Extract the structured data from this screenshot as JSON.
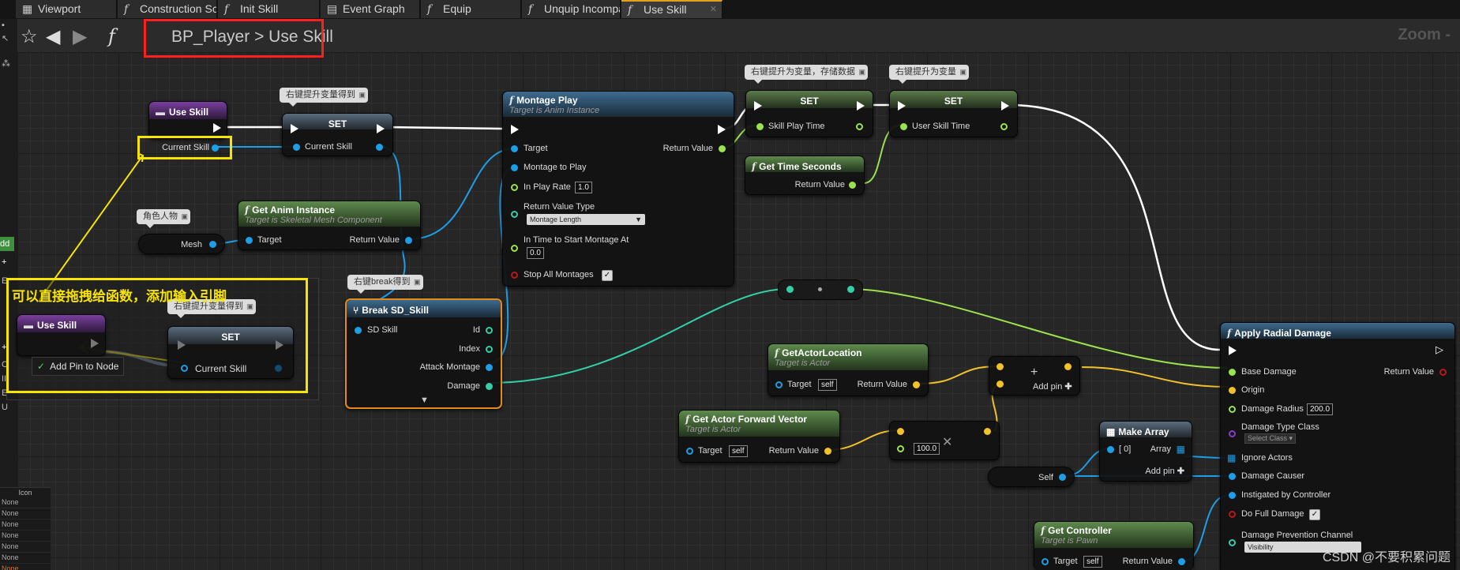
{
  "tabs": [
    {
      "label": "Viewport",
      "icon": "viewport-icon"
    },
    {
      "label": "Construction Scrip",
      "icon": "function-icon"
    },
    {
      "label": "Init Skill",
      "icon": "function-icon"
    },
    {
      "label": "Event Graph",
      "icon": "event-graph-icon"
    },
    {
      "label": "Equip",
      "icon": "function-icon"
    },
    {
      "label": "Unquip Incompatil:",
      "icon": "function-icon"
    },
    {
      "label": "Use Skill",
      "icon": "function-icon",
      "active": true
    }
  ],
  "toolbar": {
    "star_icon": "star-icon",
    "back_icon": "back-arrow-icon",
    "forward_icon": "forward-arrow-icon",
    "function_icon": "function-icon"
  },
  "breadcrumb": {
    "blueprint": "BP_Player",
    "separator": ">",
    "function": "Use Skill"
  },
  "zoom_label": "Zoom -",
  "left_panel": {
    "add_label": "dd",
    "letters": [
      "C",
      "II",
      "E",
      "U"
    ],
    "details_header": "Icon",
    "details_rows": [
      "None",
      "None",
      "None",
      "None",
      "None",
      "None",
      "None"
    ]
  },
  "comments": {
    "set1": "右键提升变量得到",
    "mesh": "角色人物",
    "break": "右键break得到",
    "set_promote_store": "右键提升为变量，存储数据",
    "set_promote": "右键提升为变量",
    "overlay_set": "右键提升变量得到"
  },
  "annotation_text": "可以直接拖拽给函数，添加输入引脚",
  "context_menu": {
    "label": "Add Pin to Node"
  },
  "nodes": {
    "use_skill": {
      "title": "Use Skill",
      "pin": "Current Skill"
    },
    "set_current": {
      "title": "SET",
      "pin": "Current Skill"
    },
    "mesh": {
      "label": "Mesh"
    },
    "get_anim": {
      "title": "Get Anim Instance",
      "subtitle": "Target is Skeletal Mesh Component",
      "in": "Target",
      "out": "Return Value"
    },
    "montage": {
      "title": "Montage Play",
      "subtitle": "Target is Anim Instance",
      "target": "Target",
      "montage": "Montage to Play",
      "rate": "In Play Rate",
      "rate_val": "1.0",
      "rtype": "Return Value Type",
      "rtype_val": "Montage Length",
      "start": "In Time to Start Montage At",
      "start_val": "0.0",
      "stop": "Stop All Montages",
      "out": "Return Value"
    },
    "break": {
      "title": "Break SD_Skill",
      "in": "SD Skill",
      "id": "Id",
      "index": "Index",
      "attack": "Attack Montage",
      "damage": "Damage"
    },
    "set_play": {
      "title": "SET",
      "pin": "Skill Play Time"
    },
    "set_user": {
      "title": "SET",
      "pin": "User Skill Time"
    },
    "get_time": {
      "title": "Get Time Seconds",
      "out": "Return Value"
    },
    "get_loc": {
      "title": "GetActorLocation",
      "subtitle": "Target is Actor",
      "in": "Target",
      "self": "self",
      "out": "Return Value"
    },
    "get_fwd": {
      "title": "Get Actor Forward Vector",
      "subtitle": "Target is Actor",
      "in": "Target",
      "self": "self",
      "out": "Return Value"
    },
    "mul": {
      "symbol": "✕",
      "val": "100.0"
    },
    "add": {
      "symbol": "+",
      "add_pin": "Add pin"
    },
    "make_array": {
      "title": "Make Array",
      "in": "[ 0]",
      "out": "Array",
      "add_pin": "Add pin"
    },
    "self_node": {
      "label": "Self"
    },
    "get_controller": {
      "title": "Get Controller",
      "subtitle": "Target is Pawn",
      "in": "Target",
      "self": "self",
      "out": "Return Value"
    },
    "apply": {
      "title": "Apply Radial Damage",
      "base": "Base Damage",
      "origin": "Origin",
      "radius": "Damage Radius",
      "radius_val": "200.0",
      "type": "Damage Type Class",
      "type_val": "Select Class",
      "ignore": "Ignore Actors",
      "causer": "Damage Causer",
      "instigated": "Instigated by Controller",
      "full": "Do Full Damage",
      "prevent": "Damage Prevention Channel",
      "prevent_val": "Visibility",
      "out": "Return Value"
    },
    "overlay_use": {
      "title": "Use Skill"
    },
    "overlay_set": {
      "title": "SET",
      "pin": "Current Skill"
    }
  },
  "watermark": "CSDN @不要积累问题",
  "colors": {
    "accent": "#e3a019",
    "annotation_yellow": "#f7e400",
    "annotation_red": "#ff1f1f",
    "object_pin": "#1d9ee8",
    "vector_pin": "#f2c22a",
    "float_pin": "#9be24c",
    "struct_pin": "#33d0a8"
  }
}
